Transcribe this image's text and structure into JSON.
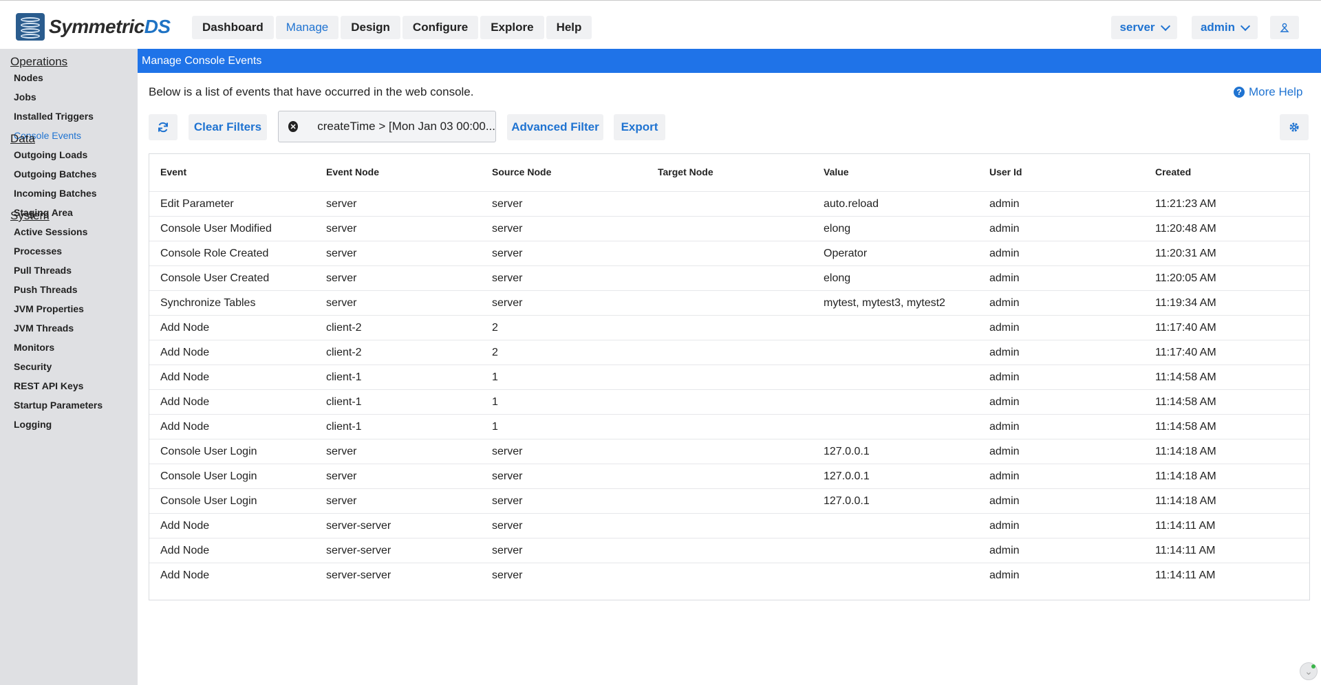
{
  "app": {
    "logo_main": "Symmetric",
    "logo_accent": "DS"
  },
  "nav": {
    "items": [
      "Dashboard",
      "Manage",
      "Design",
      "Configure",
      "Explore",
      "Help"
    ],
    "active": "Manage"
  },
  "header_right": {
    "server_label": "server",
    "user_label": "admin",
    "profile_icon": "person-icon"
  },
  "sidebar": {
    "sections": [
      {
        "title": "Operations",
        "items": [
          "Nodes",
          "Jobs",
          "Installed Triggers",
          "Console Events"
        ]
      },
      {
        "title": "Data",
        "items": [
          "Outgoing Loads",
          "Outgoing Batches",
          "Incoming Batches",
          "Staging Area"
        ]
      },
      {
        "title": "System",
        "items": [
          "Active Sessions",
          "Processes",
          "Pull Threads",
          "Push Threads",
          "JVM Properties",
          "JVM Threads",
          "Monitors",
          "Security",
          "REST API Keys",
          "Startup Parameters",
          "Logging"
        ]
      }
    ],
    "active_item": "Console Events"
  },
  "page": {
    "title": "Manage Console Events",
    "description": "Below is a list of events that have occurred in the web console.",
    "more_help": "More Help"
  },
  "toolbar": {
    "refresh_icon": "refresh-icon",
    "clear_filters": "Clear Filters",
    "filter_text": "createTime > [Mon Jan 03 00:00...",
    "advanced_filter": "Advanced Filter",
    "export": "Export",
    "settings_icon": "gear-icon"
  },
  "table": {
    "columns": [
      "Event",
      "Event Node",
      "Source Node",
      "Target Node",
      "Value",
      "User Id",
      "Created"
    ],
    "rows": [
      [
        "Edit Parameter",
        "server",
        "server",
        "",
        "auto.reload",
        "admin",
        "11:21:23 AM"
      ],
      [
        "Console User Modified",
        "server",
        "server",
        "",
        "elong",
        "admin",
        "11:20:48 AM"
      ],
      [
        "Console Role Created",
        "server",
        "server",
        "",
        "Operator",
        "admin",
        "11:20:31 AM"
      ],
      [
        "Console User Created",
        "server",
        "server",
        "",
        "elong",
        "admin",
        "11:20:05 AM"
      ],
      [
        "Synchronize Tables",
        "server",
        "server",
        "",
        "mytest, mytest3, mytest2",
        "admin",
        "11:19:34 AM"
      ],
      [
        "Add Node",
        "client-2",
        "2",
        "",
        "",
        "admin",
        "11:17:40 AM"
      ],
      [
        "Add Node",
        "client-2",
        "2",
        "",
        "",
        "admin",
        "11:17:40 AM"
      ],
      [
        "Add Node",
        "client-1",
        "1",
        "",
        "",
        "admin",
        "11:14:58 AM"
      ],
      [
        "Add Node",
        "client-1",
        "1",
        "",
        "",
        "admin",
        "11:14:58 AM"
      ],
      [
        "Add Node",
        "client-1",
        "1",
        "",
        "",
        "admin",
        "11:14:58 AM"
      ],
      [
        "Console User Login",
        "server",
        "server",
        "",
        "127.0.0.1",
        "admin",
        "11:14:18 AM"
      ],
      [
        "Console User Login",
        "server",
        "server",
        "",
        "127.0.0.1",
        "admin",
        "11:14:18 AM"
      ],
      [
        "Console User Login",
        "server",
        "server",
        "",
        "127.0.0.1",
        "admin",
        "11:14:18 AM"
      ],
      [
        "Add Node",
        "server-server",
        "server",
        "",
        "",
        "admin",
        "11:14:11 AM"
      ],
      [
        "Add Node",
        "server-server",
        "server",
        "",
        "",
        "admin",
        "11:14:11 AM"
      ],
      [
        "Add Node",
        "server-server",
        "server",
        "",
        "",
        "admin",
        "11:14:11 AM"
      ]
    ]
  },
  "colors": {
    "accent": "#1f73d1",
    "titlebar": "#1f73e8",
    "sidebar_bg": "#dfe0e3"
  }
}
